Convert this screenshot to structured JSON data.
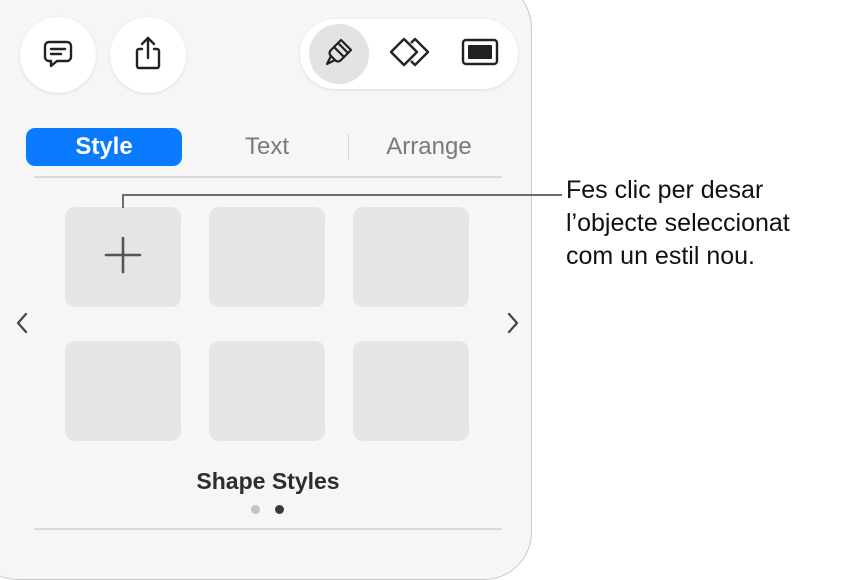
{
  "toolbar": {
    "comment_icon": "comment-bubble-icon",
    "share_icon": "share-icon",
    "format_icon": "paintbrush-icon",
    "animate_icon": "animate-diamond-icon",
    "document_icon": "document-panel-icon"
  },
  "tabs": [
    {
      "label": "Style",
      "active": true
    },
    {
      "label": "Text",
      "active": false
    },
    {
      "label": "Arrange",
      "active": false
    }
  ],
  "styles_panel": {
    "title": "Shape Styles",
    "add_tile_icon": "plus-icon",
    "prev_icon": "chevron-left-icon",
    "next_icon": "chevron-right-icon",
    "page_count": 2,
    "current_page": 2
  },
  "callout": {
    "lines": [
      "Fes clic per desar",
      "l’objecte seleccionat",
      "com un estil nou."
    ]
  },
  "colors": {
    "accent": "#0a7aff",
    "panel_bg": "#f6f6f6",
    "tile_bg": "#e5e5e5"
  }
}
